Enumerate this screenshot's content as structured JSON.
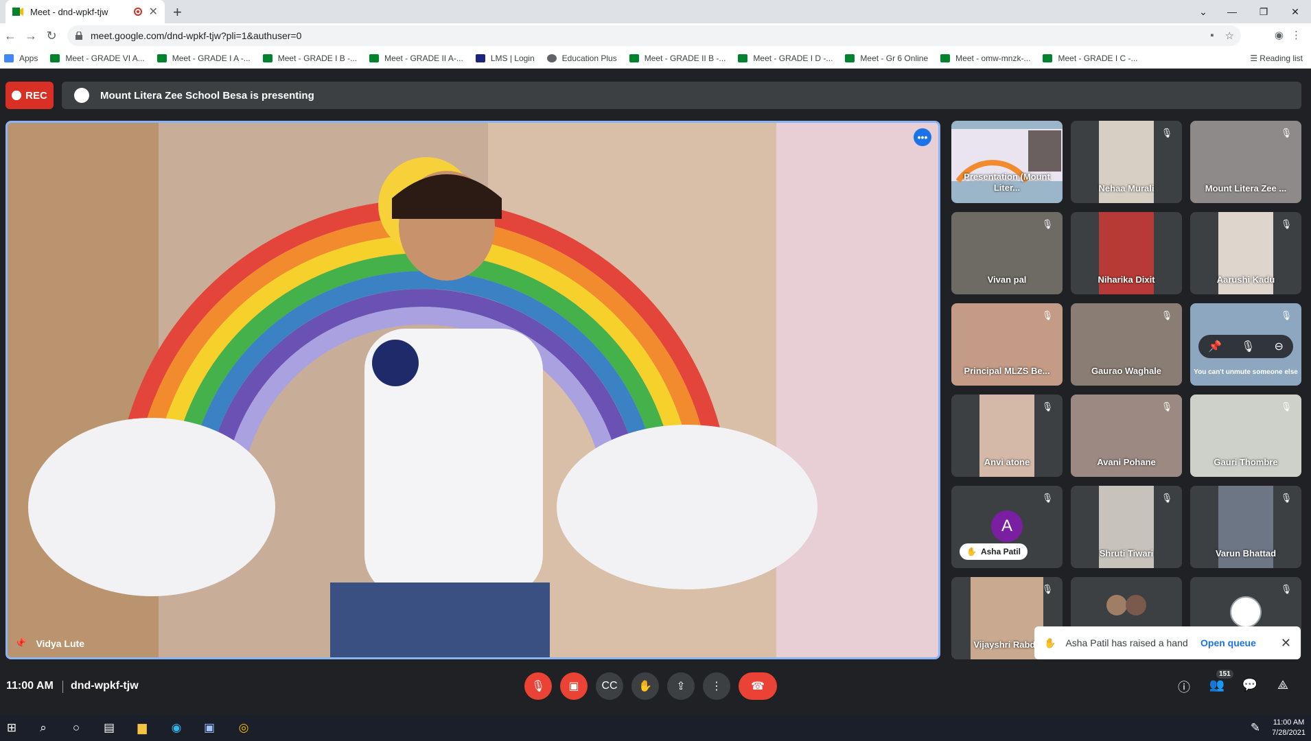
{
  "browser": {
    "tab_title": "Meet - dnd-wpkf-tjw",
    "url": "meet.google.com/dnd-wpkf-tjw?pli=1&authuser=0",
    "bookmarks": [
      {
        "label": "Apps",
        "color": "#4285f4"
      },
      {
        "label": "Meet - GRADE VI A...",
        "color": "#00832d"
      },
      {
        "label": "Meet - GRADE I A -...",
        "color": "#00832d"
      },
      {
        "label": "Meet - GRADE I B -...",
        "color": "#00832d"
      },
      {
        "label": "Meet - GRADE II A-...",
        "color": "#00832d"
      },
      {
        "label": "LMS | Login",
        "color": "#1a237e"
      },
      {
        "label": "Education Plus",
        "color": "#5f6368"
      },
      {
        "label": "Meet - GRADE II B -...",
        "color": "#00832d"
      },
      {
        "label": "Meet - GRADE I D -...",
        "color": "#00832d"
      },
      {
        "label": "Meet - Gr 6 Online",
        "color": "#00832d"
      },
      {
        "label": "Meet - omw-mnzk-...",
        "color": "#00832d"
      },
      {
        "label": "Meet - GRADE I C -...",
        "color": "#00832d"
      }
    ],
    "reading_list": "Reading list"
  },
  "meet": {
    "rec_label": "REC",
    "presenting_text": "Mount Litera Zee School Besa is presenting",
    "speaker_name": "Vidya Lute",
    "participants": [
      {
        "name": "Presentation (Mount Liter...",
        "type": "presentation"
      },
      {
        "name": "Nehaa Murali",
        "type": "video",
        "bg": "#d8cfc4"
      },
      {
        "name": "Mount Litera Zee ...",
        "type": "video",
        "bg": "#8f8a8a"
      },
      {
        "name": "Vivan pal",
        "type": "video",
        "bg": "#6e6a64"
      },
      {
        "name": "Niharika Dixit",
        "type": "video",
        "bg": "#b83a36"
      },
      {
        "name": "Aarushi Kadu",
        "type": "video",
        "bg": "#ded6cc"
      },
      {
        "name": "Principal MLZS Be...",
        "type": "video",
        "bg": "#c39b86"
      },
      {
        "name": "Gaurao Waghale",
        "type": "video",
        "bg": "#8a7e74"
      },
      {
        "name": "You can't unmute someone else",
        "type": "hover",
        "bg": "#8da7c1"
      },
      {
        "name": "Anvi atone",
        "type": "video",
        "bg": "#d4b9a8"
      },
      {
        "name": "Avani Pohane",
        "type": "video",
        "bg": "#9c8a82"
      },
      {
        "name": "Gauri Thombre",
        "type": "video",
        "bg": "#cdd1c9"
      },
      {
        "name": "Asha Patil",
        "type": "avatar",
        "initial": "A"
      },
      {
        "name": "Shruti Tiwari",
        "type": "video",
        "bg": "#c7c2bb"
      },
      {
        "name": "Varun Bhattad",
        "type": "video",
        "bg": "#6d7685"
      },
      {
        "name": "Vijayshri Rabde",
        "type": "video",
        "bg": "#c9a990"
      },
      {
        "name": "",
        "type": "group"
      },
      {
        "name": "",
        "type": "logo"
      }
    ],
    "toast": {
      "text": "Asha Patil has raised a hand",
      "action": "Open queue"
    },
    "time": "11:00 AM",
    "meeting_code": "dnd-wpkf-tjw",
    "participant_count": "151"
  },
  "taskbar": {
    "clock_time": "11:00 AM",
    "clock_date": "7/28/2021"
  },
  "colors": {
    "accent_blue": "#1a73e8",
    "end_red": "#ea4335",
    "rec_red": "#d93025"
  }
}
